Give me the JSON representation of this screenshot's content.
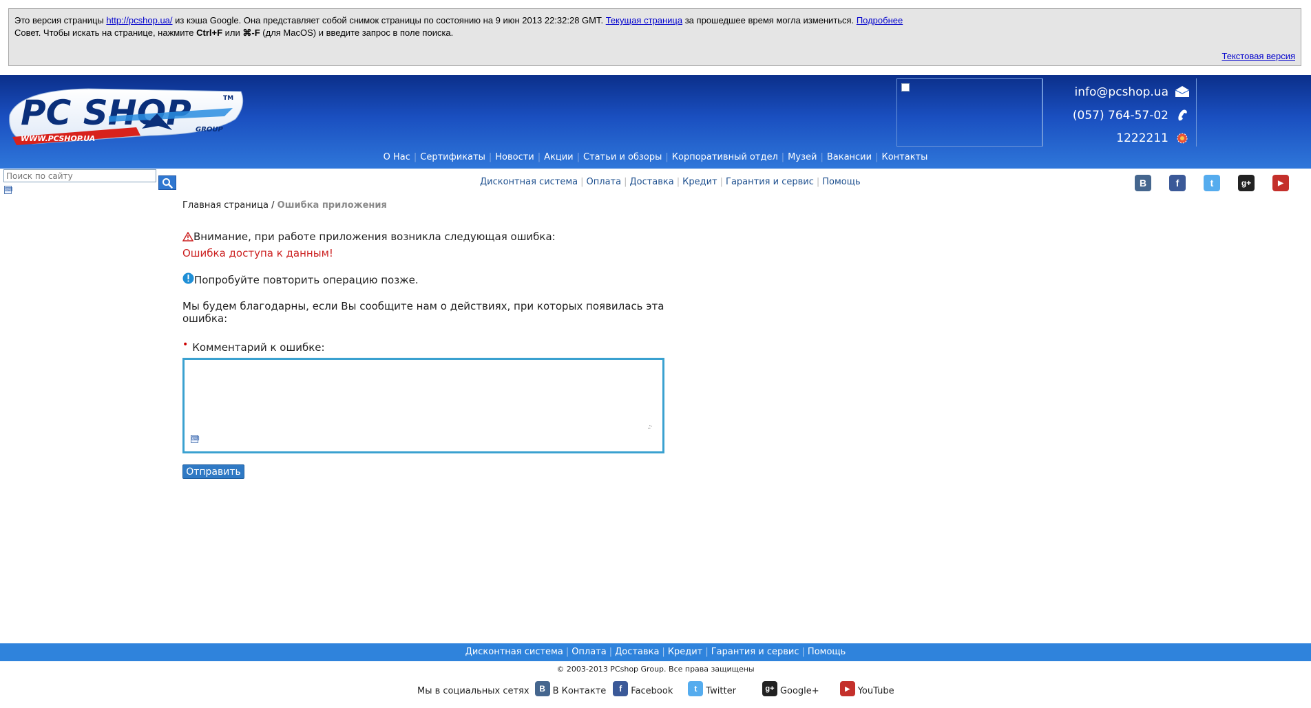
{
  "cache_banner": {
    "line1_pre": "Это версия страницы ",
    "url": "http://pcshop.ua/",
    "line1_mid": " из кэша Google. Она представляет собой снимок страницы по состоянию на 9 июн 2013 22:32:28 GMT. ",
    "current_link": "Текущая страница",
    "line1_post": " за прошедшее время могла измениться. ",
    "more_link": "Подробнее",
    "line2_pre": "Совет. Чтобы искать на странице, нажмите ",
    "key1": "Ctrl+F",
    "line2_mid": " или ",
    "key2": "⌘-F",
    "line2_post": " (для MacOS) и введите запрос в поле поиска.",
    "text_version": "Текстовая версия"
  },
  "logo": {
    "main": "PC SHOP",
    "tm": "TM",
    "group": "GROUP",
    "url": "WWW.PCSHOP.UA"
  },
  "contacts": {
    "email": "info@pcshop.ua",
    "phone": "(057) 764-57-02",
    "icq": "1222211"
  },
  "top_nav": [
    "О Нас",
    "Сертификаты",
    "Новости",
    "Акции",
    "Статьи и обзоры",
    "Корпоративный отдел",
    "Музей",
    "Вакансии",
    "Контакты"
  ],
  "search": {
    "placeholder": "Поиск по сайту"
  },
  "sub_nav": [
    "Дисконтная система",
    "Оплата",
    "Доставка",
    "Кредит",
    "Гарантия и сервис",
    "Помощь"
  ],
  "breadcrumb": {
    "home": "Главная страница",
    "sep": " / ",
    "current": "Ошибка приложения"
  },
  "error": {
    "warning": "Внимание, при работе приложения возникла следующая ошибка:",
    "detail": "Ошибка доступа к данным!",
    "retry": "Попробуйте повторить операцию позже.",
    "thanks": "Мы будем благодарны, если Вы сообщите нам о действиях, при которых появилась эта ошибка:",
    "comment_label": "Комментарий к ошибке:",
    "submit": "Отправить"
  },
  "footer_nav": [
    "Дисконтная система",
    "Оплата",
    "Доставка",
    "Кредит",
    "Гарантия и сервис",
    "Помощь"
  ],
  "copyright": "© 2003-2013 PCshop Group. Все права защищены",
  "footer_social": {
    "intro": "Мы в социальных сетях",
    "vk": "В Контакте",
    "facebook": "Facebook",
    "twitter": "Twitter",
    "google": "Google+",
    "youtube": "YouTube"
  },
  "colors": {
    "header_top": "#0b2f8a",
    "header_bottom": "#2f77da",
    "footer_bar": "#2f83dc",
    "error_red": "#cc2222",
    "textarea_border": "#3aa1d0",
    "vk": "#45668e",
    "facebook": "#3b5998",
    "twitter": "#55acee",
    "google": "#222222",
    "youtube": "#c4302b"
  }
}
